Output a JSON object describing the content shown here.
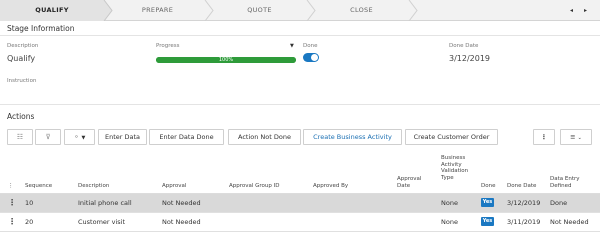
{
  "stages": [
    {
      "label": "QUALIFY",
      "active": true
    },
    {
      "label": "PREPARE",
      "active": false
    },
    {
      "label": "QUOTE",
      "active": false
    },
    {
      "label": "CLOSE",
      "active": false
    }
  ],
  "stage_nav": {
    "prev": "◂",
    "next": "▸"
  },
  "stage_info": {
    "title": "Stage Information",
    "description_label": "Description",
    "description_value": "Qualify",
    "progress_label": "Progress",
    "progress_value": 100,
    "progress_text": "100%",
    "done_label": "Done",
    "done_on": true,
    "done_date_label": "Done Date",
    "done_date_value": "3/12/2019",
    "instruction_label": "Instruction"
  },
  "actions": {
    "title": "Actions",
    "buttons": {
      "enter_data": "Enter Data",
      "enter_data_done": "Enter Data Done",
      "action_not_done": "Action Not Done",
      "create_business_activity": "Create Business Activity",
      "create_customer_order": "Create Customer Order"
    },
    "columns": {
      "sequence": "Sequence",
      "description": "Description",
      "approval": "Approval",
      "approval_group_id": "Approval Group ID",
      "approved_by": "Approved By",
      "approval_date_1": "Approval",
      "approval_date_2": "Date",
      "bav_1": "Business",
      "bav_2": "Activity",
      "bav_3": "Validation",
      "bav_4": "Type",
      "done": "Done",
      "done_date": "Done Date",
      "ded_1": "Data Entry",
      "ded_2": "Defined"
    },
    "rows": [
      {
        "sequence": "10",
        "description": "Initial phone call",
        "approval": "Not Needed",
        "validation_type": "None",
        "done": "Yes",
        "done_date": "3/12/2019",
        "data_entry": "Done"
      },
      {
        "sequence": "20",
        "description": "Customer visit",
        "approval": "Not Needed",
        "validation_type": "None",
        "done": "Yes",
        "done_date": "3/11/2019",
        "data_entry": "Not Needed"
      }
    ]
  },
  "colors": {
    "accent": "#1a78c2",
    "progress": "#2e9b3a"
  }
}
